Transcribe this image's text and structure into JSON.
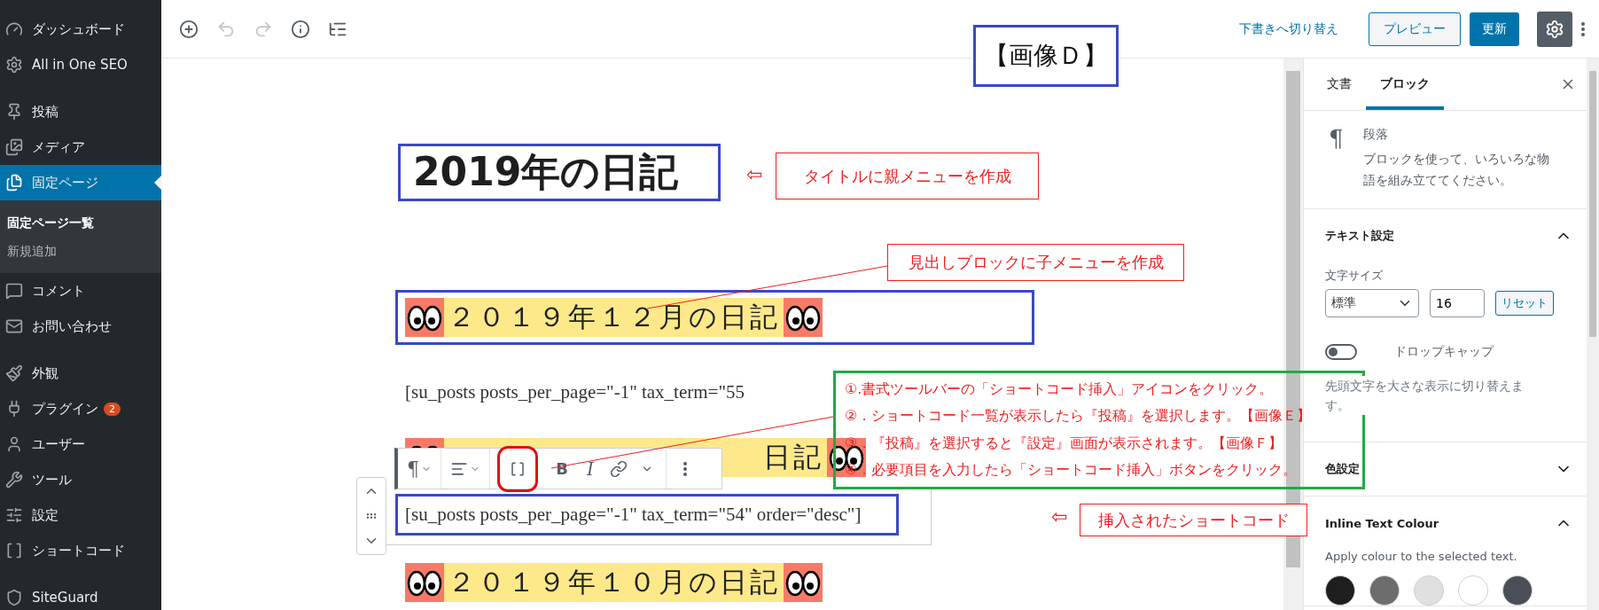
{
  "sidebar": {
    "groups": [
      {
        "items": [
          {
            "label": "ダッシュボード",
            "selected": false
          },
          {
            "label": "All in One SEO",
            "selected": false
          }
        ]
      },
      {
        "items": [
          {
            "label": "投稿",
            "selected": false
          },
          {
            "label": "メディア",
            "selected": false
          },
          {
            "label": "固定ページ",
            "selected": true,
            "children": [
              {
                "label": "固定ページ一覧",
                "selected": true
              },
              {
                "label": "新規追加",
                "selected": false
              }
            ]
          },
          {
            "label": "コメント",
            "selected": false
          },
          {
            "label": "お問い合わせ",
            "selected": false
          }
        ]
      },
      {
        "items": [
          {
            "label": "外観",
            "selected": false
          },
          {
            "label": "プラグイン",
            "selected": false,
            "badge": "2"
          },
          {
            "label": "ユーザー",
            "selected": false
          },
          {
            "label": "ツール",
            "selected": false
          },
          {
            "label": "設定",
            "selected": false
          },
          {
            "label": "ショートコード",
            "selected": false
          }
        ]
      },
      {
        "items": [
          {
            "label": "SiteGuard",
            "selected": false
          }
        ]
      }
    ]
  },
  "toolbar": {
    "tools": [
      {
        "disabled": false
      },
      {
        "disabled": true
      },
      {
        "disabled": true
      },
      {
        "disabled": false
      },
      {
        "disabled": false
      }
    ],
    "switch_to_draft": "下書きへ切り替え",
    "preview": "プレビュー",
    "update": "更新",
    "settings_active": true
  },
  "editor": {
    "title": "2019年の日記",
    "blocks": [
      {
        "kind": "heading",
        "selected": false,
        "framed": true,
        "text": "２０１９年１２月の日記"
      },
      {
        "kind": "paragraph",
        "selected": false,
        "framed": false,
        "text": "[su_posts posts_per_page=\"-1\" tax_term=\"55"
      },
      {
        "kind": "heading",
        "selected": false,
        "framed": false,
        "text": "日記"
      },
      {
        "kind": "paragraph",
        "selected": true,
        "framed": true,
        "text": "[su_posts posts_per_page=\"-1\" tax_term=\"54\" order=\"desc\"]"
      },
      {
        "kind": "heading",
        "selected": false,
        "framed": false,
        "text": "２０１９年１０月の日記"
      }
    ],
    "block_toolbar": {
      "paragraph": "¶",
      "bold": "B",
      "italic": "I"
    }
  },
  "settings_panel": {
    "tabs": [
      {
        "label": "文書",
        "selected": false
      },
      {
        "label": "ブロック",
        "selected": true
      }
    ],
    "block": {
      "icon": "¶",
      "name": "段落",
      "description": "ブロックを使って、いろいろな物語を組み立ててください。"
    },
    "sections": [
      {
        "kind": "text_settings",
        "title": "テキスト設定",
        "expanded": true,
        "font_size_label": "文字サイズ",
        "font_size": "標準",
        "custom_size": "16",
        "reset": "リセット",
        "drop_cap": {
          "label": "ドロップキャップ",
          "on": false,
          "help": "先頭文字を大さな表示に切り替えます。"
        }
      },
      {
        "title": "色設定",
        "expanded": false
      },
      {
        "kind": "colors",
        "title": "Inline Text Colour",
        "expanded": true,
        "help": "Apply colour to the selected text.",
        "swatches": [
          {
            "color": "#1e1e1e"
          },
          {
            "color": "#6d6d6d"
          },
          {
            "color": "#e0e0e0"
          },
          {
            "color": "#ffffff"
          },
          {
            "color": "#4a4f57"
          }
        ]
      }
    ]
  },
  "annotations": {
    "image_label": "【画像Ｄ】",
    "arrow": "⇦",
    "title_note": "タイトルに親メニューを作成",
    "heading_note": "見出しブロックに子メニューを作成",
    "steps": [
      "①.書式ツールバーの「ショートコード挿入」アイコンをクリック。",
      "②．ショートコード一覧が表示したら『投稿』を選択します。【画像Ｅ】",
      "③．『投稿』を選択すると『設定』画面が表示されます。【画像Ｆ】",
      "④．必要項目を入力したら「ショートコード挿入」ボタンをクリック。"
    ],
    "shortcode_arrow": "⇦",
    "shortcode_note": "挿入されたショートコード"
  }
}
